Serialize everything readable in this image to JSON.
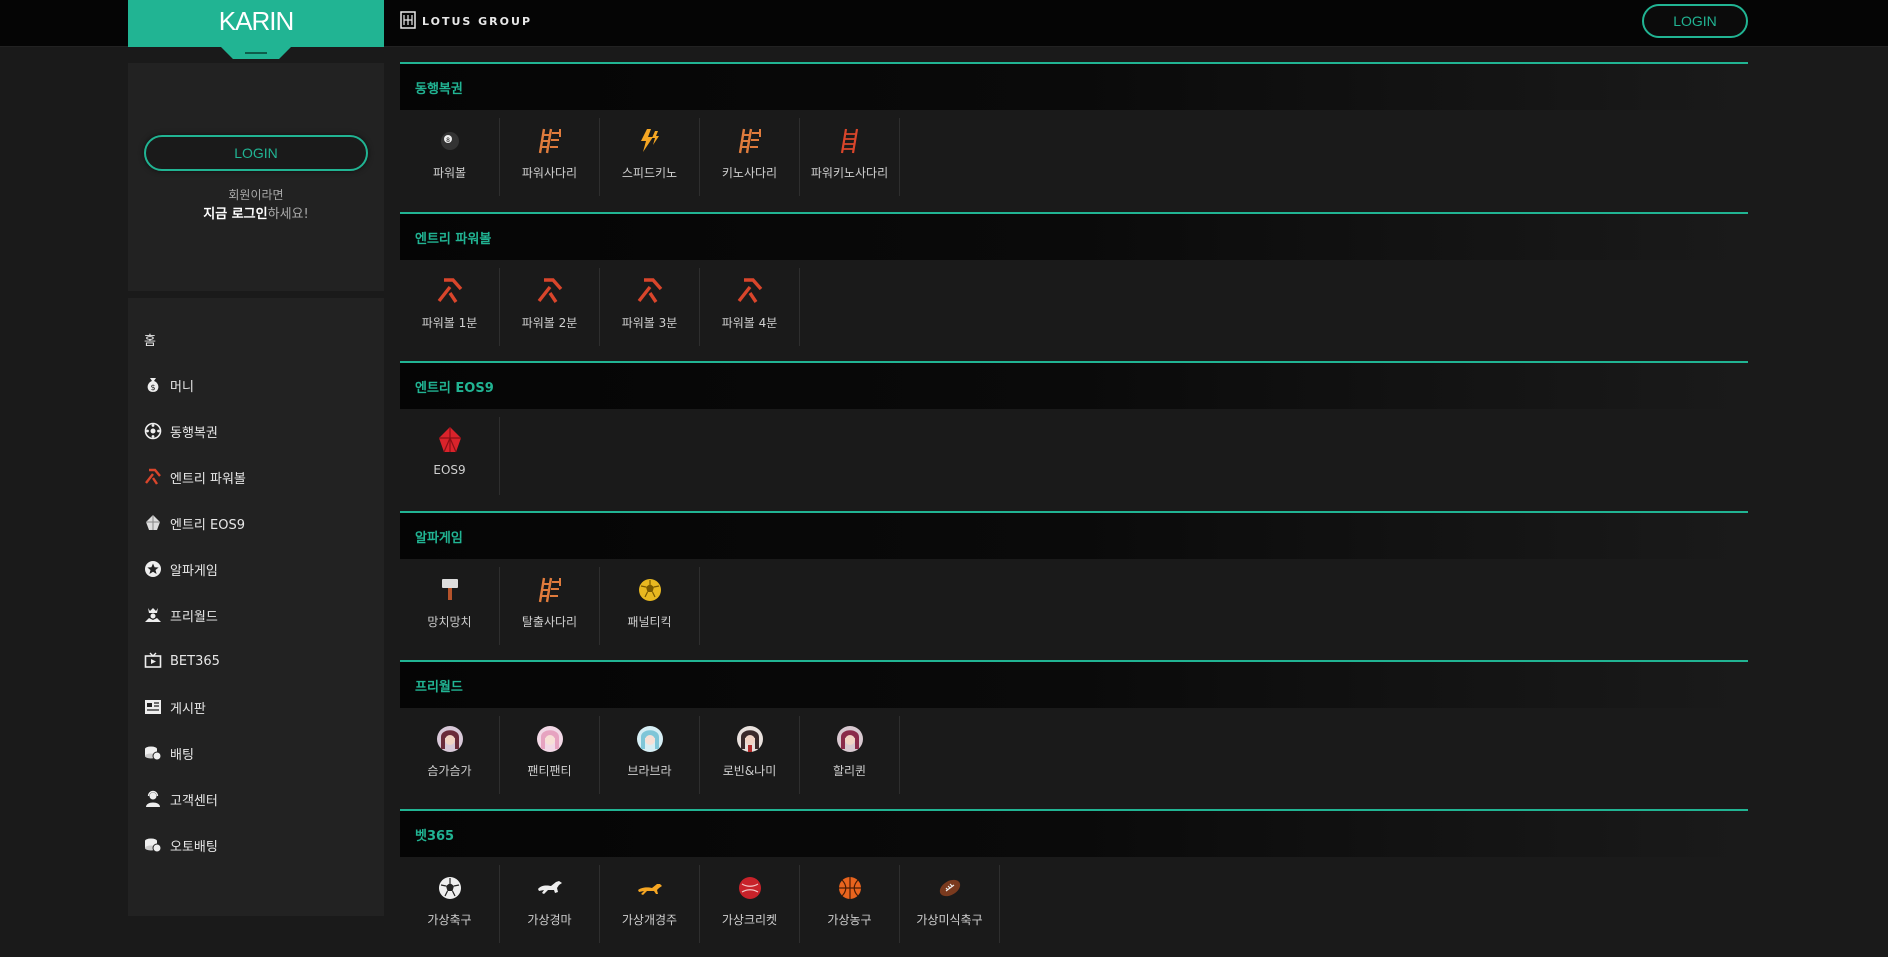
{
  "header": {
    "logo_text": "KARIN",
    "brand": "LOTUS GROUP",
    "login_label": "LOGIN"
  },
  "sidebar": {
    "login_button": "LOGIN",
    "message_line1": "회원이라면",
    "message_bold": "지금 로그인",
    "message_rest": "하세요!",
    "items": [
      {
        "label": "홈",
        "icon": "home"
      },
      {
        "label": "머니",
        "icon": "money-bag-icon"
      },
      {
        "label": "동행복권",
        "icon": "lottery-ball-icon"
      },
      {
        "label": "엔트리 파워볼",
        "icon": "powerball-icon"
      },
      {
        "label": "엔트리 EOS9",
        "icon": "eos-icon"
      },
      {
        "label": "알파게임",
        "icon": "star-icon"
      },
      {
        "label": "프리월드",
        "icon": "crown-person-icon"
      },
      {
        "label": "BET365",
        "icon": "tv-icon"
      },
      {
        "label": "게시판",
        "icon": "board-icon"
      },
      {
        "label": "배팅",
        "icon": "coins-icon"
      },
      {
        "label": "고객센터",
        "icon": "support-icon"
      },
      {
        "label": "오토배팅",
        "icon": "coins-icon"
      }
    ]
  },
  "sections": [
    {
      "title": "동행복권",
      "games": [
        {
          "label": "파워볼",
          "icon": "8ball-icon"
        },
        {
          "label": "파워사다리",
          "icon": "ladder-icon"
        },
        {
          "label": "스피드키노",
          "icon": "lightning-icon"
        },
        {
          "label": "키노사다리",
          "icon": "ladder-icon"
        },
        {
          "label": "파워키노사다리",
          "icon": "ladder-red-icon"
        }
      ]
    },
    {
      "title": "엔트리 파워볼",
      "games": [
        {
          "label": "파워볼 1분",
          "icon": "powerball-icon"
        },
        {
          "label": "파워볼 2분",
          "icon": "powerball-icon"
        },
        {
          "label": "파워볼 3분",
          "icon": "powerball-icon"
        },
        {
          "label": "파워볼 4분",
          "icon": "powerball-icon"
        }
      ]
    },
    {
      "title": "엔트리 EOS9",
      "games": [
        {
          "label": "EOS9",
          "icon": "eos-icon"
        }
      ]
    },
    {
      "title": "알파게임",
      "games": [
        {
          "label": "망치망치",
          "icon": "hammer-icon"
        },
        {
          "label": "탈출사다리",
          "icon": "ladder-icon"
        },
        {
          "label": "패널티킥",
          "icon": "soccer-gold-icon"
        }
      ]
    },
    {
      "title": "프리월드",
      "games": [
        {
          "label": "슴가슴가",
          "icon": "avatar-icon"
        },
        {
          "label": "팬티팬티",
          "icon": "avatar-icon"
        },
        {
          "label": "브라브라",
          "icon": "avatar-icon"
        },
        {
          "label": "로빈&나미",
          "icon": "avatar-icon"
        },
        {
          "label": "할리퀸",
          "icon": "avatar-icon"
        }
      ]
    },
    {
      "title": "벳365",
      "games": [
        {
          "label": "가상축구",
          "icon": "soccer-icon"
        },
        {
          "label": "가상경마",
          "icon": "horse-icon"
        },
        {
          "label": "가상개경주",
          "icon": "dog-icon"
        },
        {
          "label": "가상크리켓",
          "icon": "cricket-icon"
        },
        {
          "label": "가상농구",
          "icon": "basketball-icon"
        },
        {
          "label": "가상미식축구",
          "icon": "football-icon"
        }
      ]
    }
  ],
  "colors": {
    "accent": "#21b493",
    "ladder": "#e07b3c",
    "powerball": "#d9452b"
  }
}
